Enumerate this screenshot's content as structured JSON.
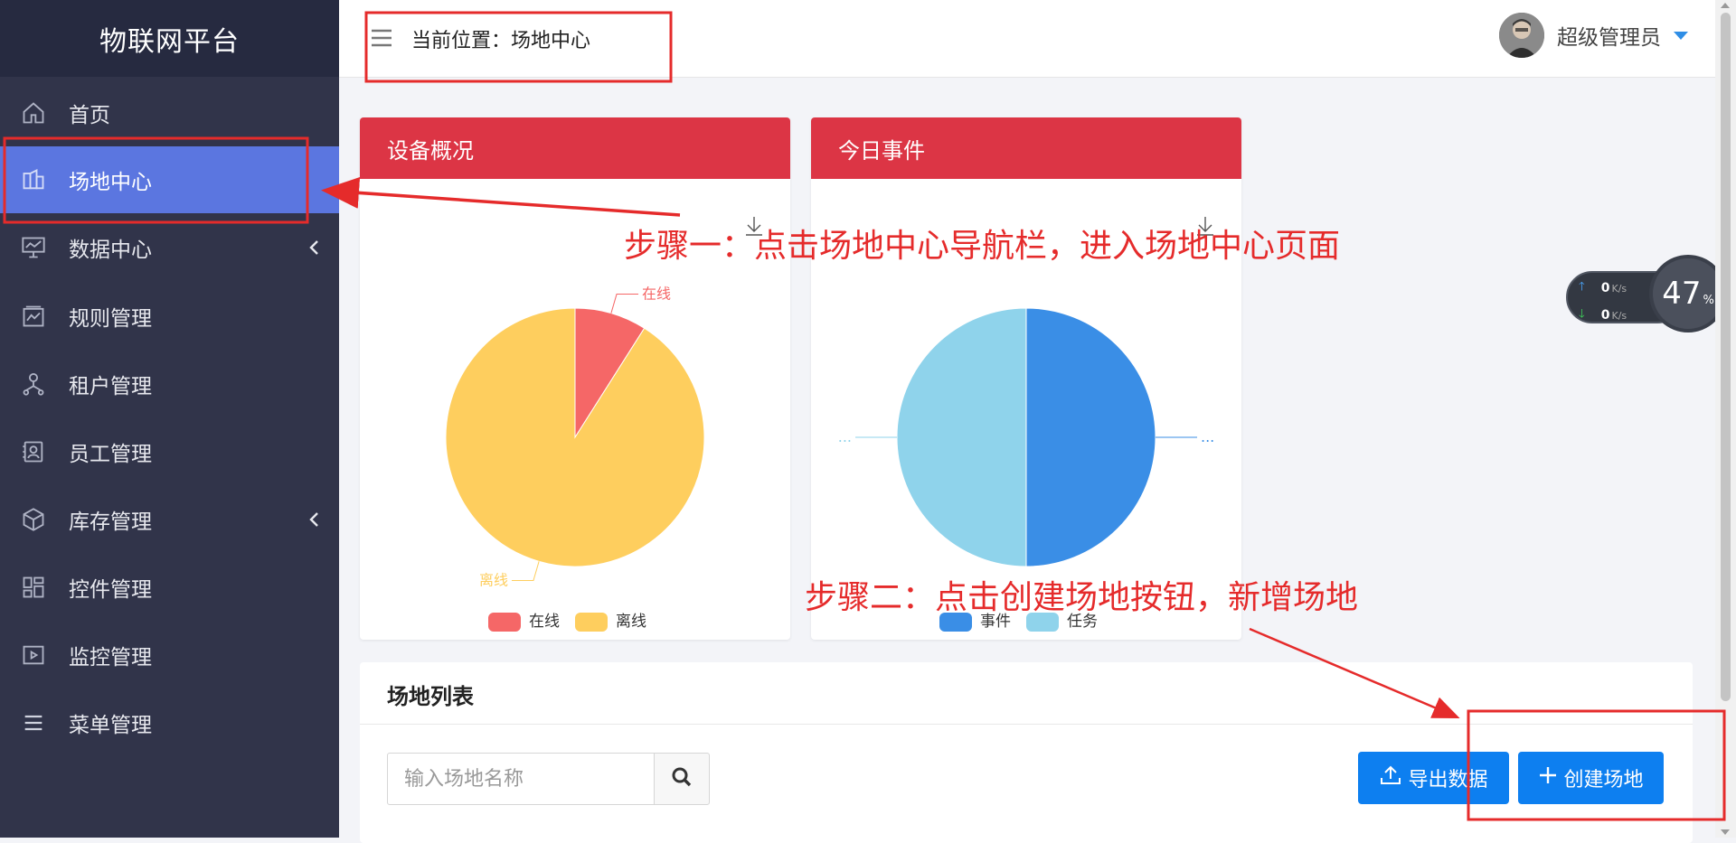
{
  "app": {
    "title": "物联网平台"
  },
  "header": {
    "breadcrumb": "当前位置：场地中心",
    "user_name": "超级管理员"
  },
  "sidebar": {
    "items": [
      {
        "label": "首页",
        "icon": "home-icon",
        "active": false,
        "has_submenu": false
      },
      {
        "label": "场地中心",
        "icon": "venue-icon",
        "active": true,
        "has_submenu": false
      },
      {
        "label": "数据中心",
        "icon": "monitor-chart-icon",
        "active": false,
        "has_submenu": true
      },
      {
        "label": "规则管理",
        "icon": "rules-icon",
        "active": false,
        "has_submenu": false
      },
      {
        "label": "租户管理",
        "icon": "tenant-icon",
        "active": false,
        "has_submenu": false
      },
      {
        "label": "员工管理",
        "icon": "staff-icon",
        "active": false,
        "has_submenu": false
      },
      {
        "label": "库存管理",
        "icon": "cube-icon",
        "active": false,
        "has_submenu": true
      },
      {
        "label": "控件管理",
        "icon": "widgets-icon",
        "active": false,
        "has_submenu": false
      },
      {
        "label": "监控管理",
        "icon": "video-icon",
        "active": false,
        "has_submenu": false
      },
      {
        "label": "菜单管理",
        "icon": "menu-list-icon",
        "active": false,
        "has_submenu": false
      }
    ]
  },
  "cards": {
    "device_overview": {
      "title": "设备概况"
    },
    "today_events": {
      "title": "今日事件"
    }
  },
  "chart_data": [
    {
      "type": "pie",
      "title": "设备概况",
      "labels": [
        "在线",
        "离线"
      ],
      "values": [
        9,
        91
      ],
      "colors": [
        "#f56767",
        "#fece5e"
      ],
      "legend": "bottom"
    },
    {
      "type": "pie",
      "title": "今日事件",
      "labels": [
        "事件",
        "任务"
      ],
      "values": [
        50,
        50
      ],
      "colors": [
        "#3a8ee6",
        "#8fd3eb"
      ],
      "slice_labels": [
        "...",
        "..."
      ],
      "legend": "bottom"
    }
  ],
  "venue_list": {
    "title": "场地列表",
    "search_placeholder": "输入场地名称",
    "export_label": "导出数据",
    "create_label": "创建场地"
  },
  "speed_widget": {
    "up": "0",
    "down": "0",
    "unit": "K/s",
    "percent": "47",
    "percent_sign": "%"
  },
  "annotations": {
    "step1": "步骤一：点击场地中心导航栏，进入场地中心页面",
    "step2": "步骤二：点击创建场地按钮，新增场地",
    "color": "#e52b2b"
  }
}
